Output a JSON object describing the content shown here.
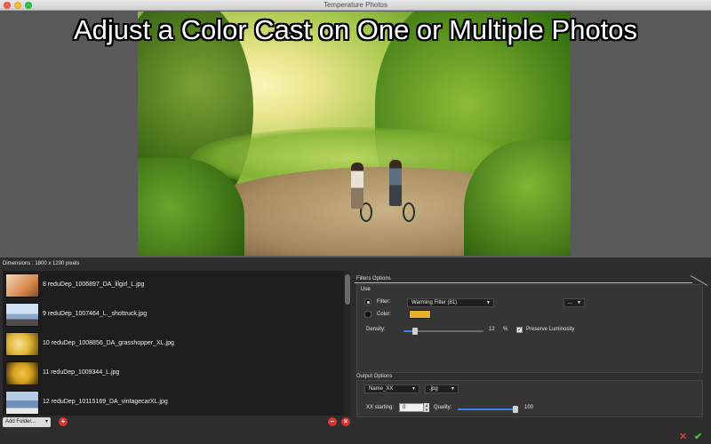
{
  "window": {
    "title": "Temperature Photos"
  },
  "headline": "Adjust a Color Cast on One or Multiple Photos",
  "dimensions_text": "Dimensions : 1800 x 1200 pixels",
  "files": [
    {
      "name": "8 reduDep_1006897_DA_lilgirl_L.jpg",
      "thumb_color": "#d98a4f"
    },
    {
      "name": "9 reduDep_1007464_L._shottruck.jpg",
      "thumb_color": "#8fa7c9"
    },
    {
      "name": "10 reduDep_1008856_DA_grasshopper_XL.jpg",
      "thumb_color": "#e0b232"
    },
    {
      "name": "11 reduDep_1009344_L.jpg",
      "thumb_color": "#d5a21f"
    },
    {
      "name": "12 reduDep_10115169_DA_vintagecarXL.jpg",
      "thumb_color": "#6f8fb8"
    }
  ],
  "bottom_left": {
    "add_folder_label": "Add Folder...",
    "add_icon": "plus-icon",
    "remove_icon": "minus-icon",
    "clear_icon": "x-icon"
  },
  "filters": {
    "tab_label": "Filters Options",
    "use_label": "Use",
    "filter_label": "Filter:",
    "filter_value": "Warming Filter (81)",
    "more_button": "...",
    "color_label": "Color:",
    "color_value": "#e8b02a",
    "density_label": "Density:",
    "density_value": "12",
    "density_unit": "%",
    "density_fraction": 0.12,
    "preserve_label": "Preserve Luminosity",
    "preserve_checked": "✓"
  },
  "output": {
    "section_label": "Output Options",
    "name_value": "Name_XX",
    "format_value": ".jpg",
    "xx_label": "XX starting:",
    "xx_value": "0",
    "quality_label": "Quality:",
    "quality_value": "100",
    "quality_fraction": 1.0
  },
  "footer": {
    "cancel_icon": "cancel-x-icon",
    "ok_icon": "checkmark-icon"
  }
}
